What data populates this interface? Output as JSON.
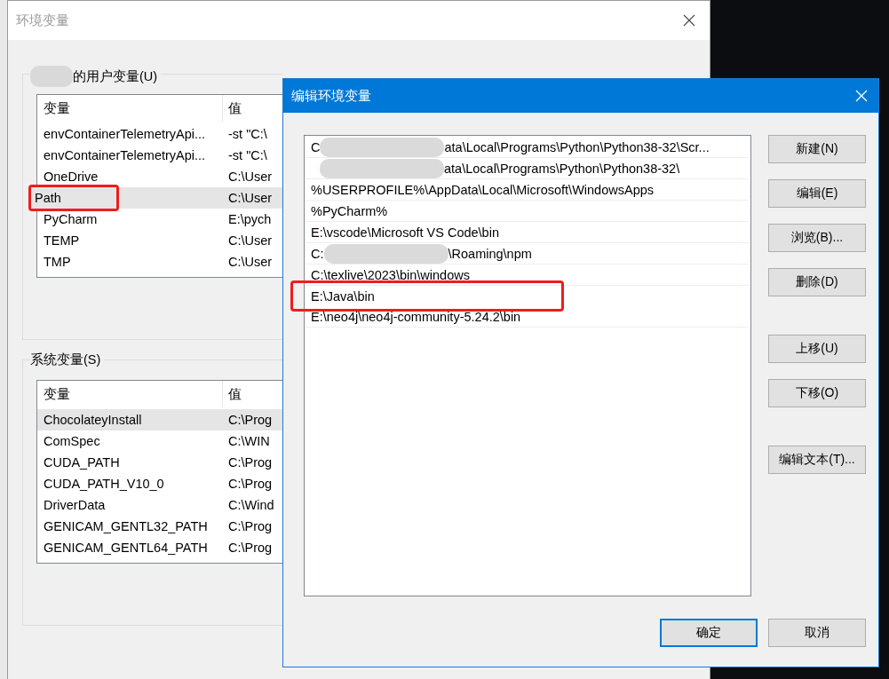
{
  "env_window": {
    "title": "环境变量",
    "user_group": {
      "label": "的用户变量(U)",
      "columns": [
        "变量",
        "值"
      ],
      "rows": [
        {
          "name": "envContainerTelemetryApi...",
          "value": "-st \"C:\\",
          "selected": false,
          "circled": false
        },
        {
          "name": "envContainerTelemetryApi...",
          "value": "-st \"C:\\",
          "selected": false,
          "circled": false
        },
        {
          "name": "OneDrive",
          "value": "C:\\User",
          "selected": false,
          "circled": false
        },
        {
          "name": "Path",
          "value": "C:\\User",
          "selected": true,
          "circled": true
        },
        {
          "name": "PyCharm",
          "value": "E:\\pych",
          "selected": false,
          "circled": false
        },
        {
          "name": "TEMP",
          "value": "C:\\User",
          "selected": false,
          "circled": false
        },
        {
          "name": "TMP",
          "value": "C:\\User",
          "selected": false,
          "circled": false
        }
      ]
    },
    "system_group": {
      "label": "系统变量(S)",
      "columns": [
        "变量",
        "值"
      ],
      "rows": [
        {
          "name": "ChocolateyInstall",
          "value": "C:\\Prog",
          "selected": true,
          "circled": false
        },
        {
          "name": "ComSpec",
          "value": "C:\\WIN",
          "selected": false,
          "circled": false
        },
        {
          "name": "CUDA_PATH",
          "value": "C:\\Prog",
          "selected": false,
          "circled": false
        },
        {
          "name": "CUDA_PATH_V10_0",
          "value": "C:\\Prog",
          "selected": false,
          "circled": false
        },
        {
          "name": "DriverData",
          "value": "C:\\Wind",
          "selected": false,
          "circled": false
        },
        {
          "name": "GENICAM_GENTL32_PATH",
          "value": "C:\\Prog",
          "selected": false,
          "circled": false
        },
        {
          "name": "GENICAM_GENTL64_PATH",
          "value": "C:\\Prog",
          "selected": false,
          "circled": false
        }
      ]
    }
  },
  "edit_dialog": {
    "title": "编辑环境变量",
    "paths": [
      {
        "prefix": "C",
        "text": "ata\\Local\\Programs\\Python\\Python38-32\\Scr...",
        "redacted": true,
        "circled": false
      },
      {
        "text": "ata\\Local\\Programs\\Python\\Python38-32\\",
        "redacted": true,
        "circled": false
      },
      {
        "text": "%USERPROFILE%\\AppData\\Local\\Microsoft\\WindowsApps",
        "redacted": false,
        "circled": false
      },
      {
        "text": "%PyCharm%",
        "redacted": false,
        "circled": false
      },
      {
        "text": "E:\\vscode\\Microsoft VS Code\\bin",
        "redacted": false,
        "circled": false
      },
      {
        "prefix": "C:",
        "text": "\\Roaming\\npm",
        "redacted": true,
        "circled": false
      },
      {
        "text": "C:\\texlive\\2023\\bin\\windows",
        "redacted": false,
        "circled": false
      },
      {
        "text": "E:\\Java\\bin",
        "redacted": false,
        "circled": true
      },
      {
        "text": "E:\\neo4j\\neo4j-community-5.24.2\\bin",
        "redacted": false,
        "circled": false
      }
    ],
    "button_groups": [
      [
        "新建(N)",
        "编辑(E)",
        "浏览(B)...",
        "删除(D)"
      ],
      [
        "上移(U)",
        "下移(O)"
      ],
      [
        "编辑文本(T)..."
      ]
    ],
    "footer_buttons": [
      {
        "label": "确定",
        "default": true
      },
      {
        "label": "取消",
        "default": false
      }
    ]
  }
}
